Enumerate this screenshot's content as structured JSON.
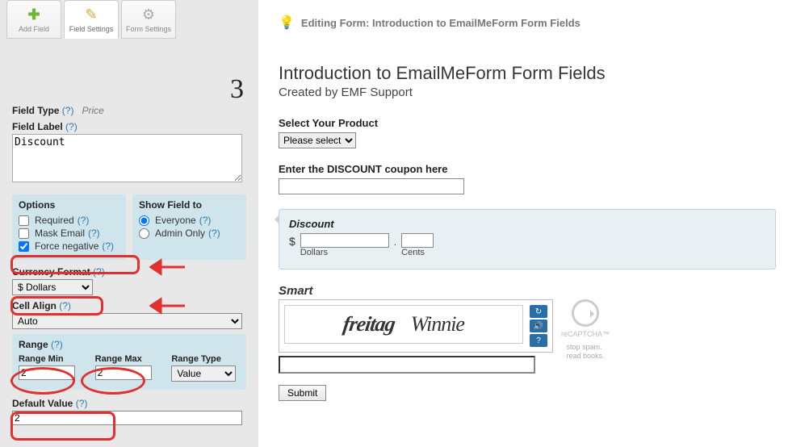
{
  "tabs": {
    "add": "Add Field",
    "field": "Field Settings",
    "form": "Form Settings"
  },
  "step_number": "3",
  "field_type_label": "Field Type",
  "field_type_value": "Price",
  "field_label_label": "Field Label",
  "field_label_value": "Discount",
  "help_q": "(?)",
  "options": {
    "title": "Options",
    "required": "Required",
    "mask_email": "Mask Email",
    "force_negative": "Force negative"
  },
  "show_field": {
    "title": "Show Field to",
    "everyone": "Everyone",
    "admin": "Admin Only"
  },
  "currency_format_label": "Currency Format",
  "currency_format_value": "$ Dollars",
  "cell_align_label": "Cell Align",
  "cell_align_value": "Auto",
  "range": {
    "title": "Range",
    "min_label": "Range Min",
    "min_value": "2",
    "max_label": "Range Max",
    "max_value": "2",
    "type_label": "Range Type",
    "type_value": "Value"
  },
  "default_value_label": "Default Value",
  "default_value_value": "2",
  "editing_bar": "Editing Form: Introduction to EmailMeForm Form Fields",
  "form": {
    "title": "Introduction to EmailMeForm Form Fields",
    "subtitle": "Created by EMF Support",
    "select_product_label": "Select Your Product",
    "select_product_value": "Please select",
    "coupon_label": "Enter the DISCOUNT coupon here",
    "discount_label": "Discount",
    "currency_symbol": "$",
    "dollars": "Dollars",
    "cents": "Cents",
    "smart_label": "Smart",
    "captcha_words": [
      "freitag",
      "Winnie"
    ],
    "recaptcha": "reCAPTCHA™",
    "tagline1": "stop spam.",
    "tagline2": "read books.",
    "submit": "Submit"
  }
}
